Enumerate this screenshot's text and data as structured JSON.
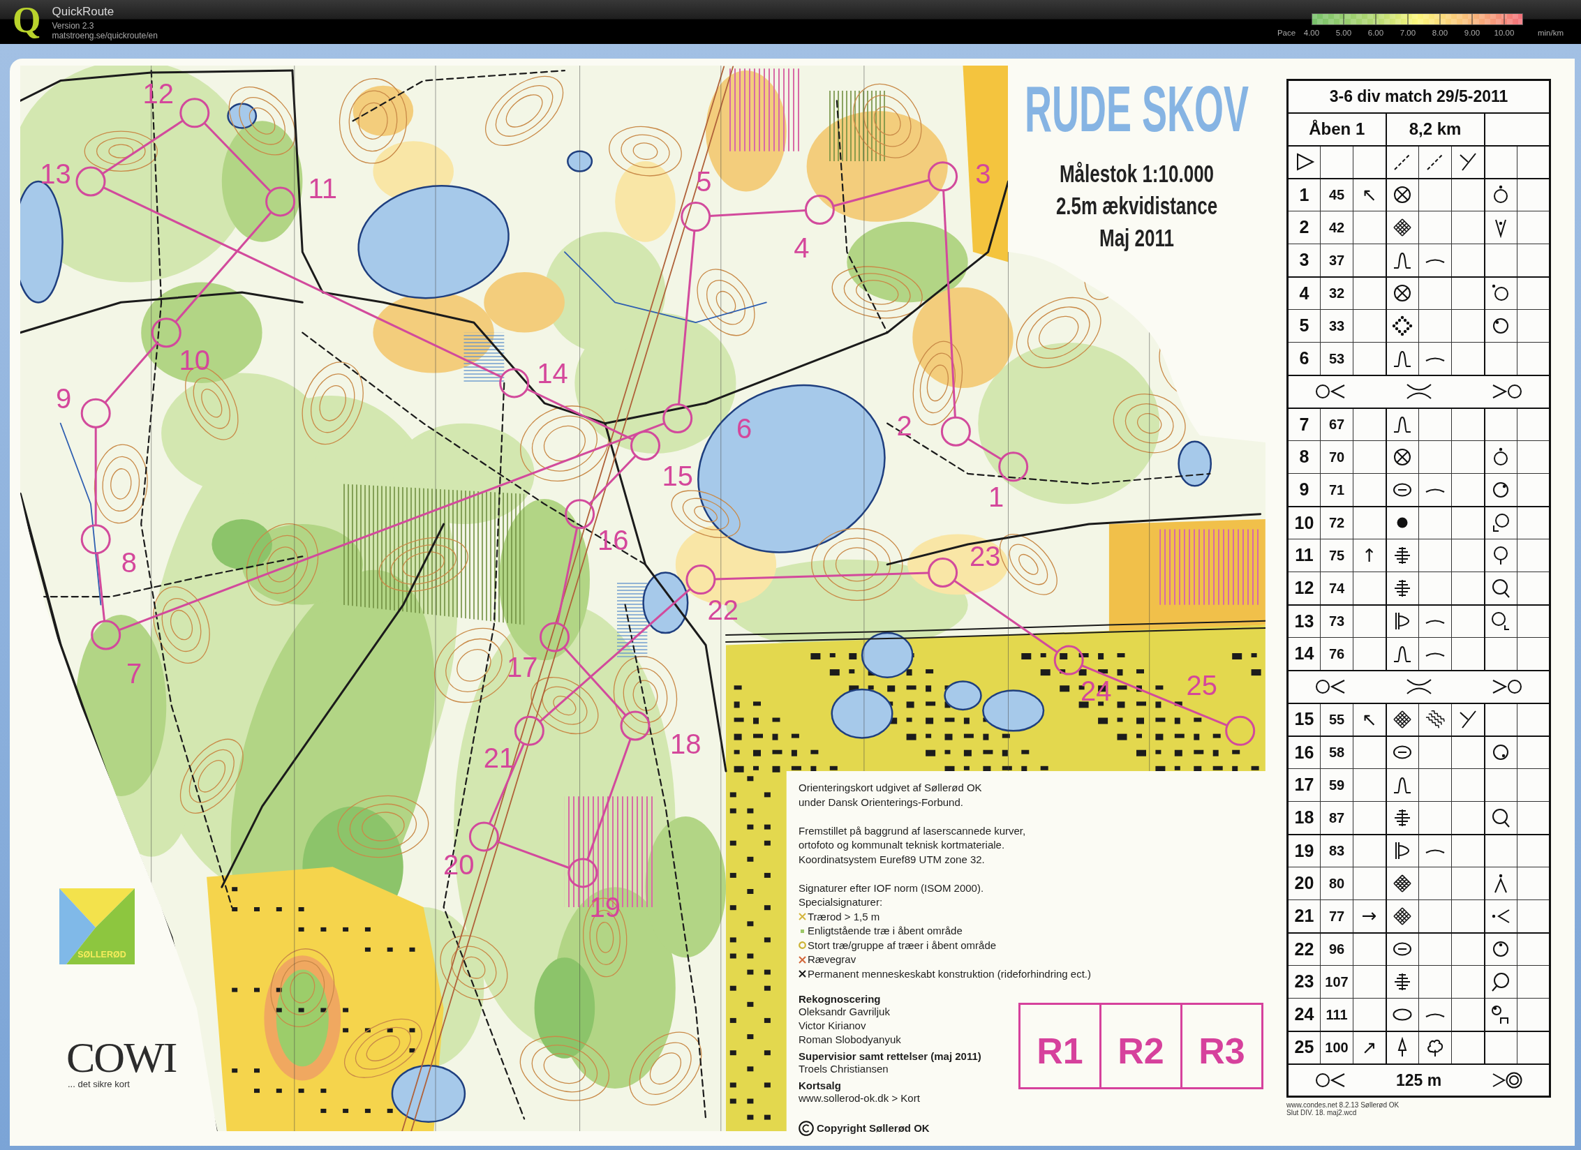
{
  "app_bar": {
    "logo_letter": "Q",
    "name": "QuickRoute",
    "version": "Version 2.3",
    "url": "matstroeng.se/quickroute/en",
    "pace_legend": {
      "label": "Pace",
      "ticks": [
        "4.00",
        "5.00",
        "6.00",
        "7.00",
        "8.00",
        "9.00",
        "10.00"
      ],
      "unit": "min/km"
    }
  },
  "map": {
    "title": "RUDE SKOV",
    "info_lines": [
      "Målestok 1:10.000",
      "2.5m ækvidistance",
      "Maj 2011"
    ],
    "controls": [
      {
        "number": "1"
      },
      {
        "number": "2"
      },
      {
        "number": "3"
      },
      {
        "number": "4"
      },
      {
        "number": "5"
      },
      {
        "number": "6"
      },
      {
        "number": "7"
      },
      {
        "number": "8"
      },
      {
        "number": "9"
      },
      {
        "number": "10"
      },
      {
        "number": "11"
      },
      {
        "number": "12"
      },
      {
        "number": "13"
      },
      {
        "number": "14"
      },
      {
        "number": "15"
      },
      {
        "number": "16"
      },
      {
        "number": "17"
      },
      {
        "number": "18"
      },
      {
        "number": "19"
      },
      {
        "number": "20"
      },
      {
        "number": "21"
      },
      {
        "number": "22"
      },
      {
        "number": "23"
      },
      {
        "number": "24"
      },
      {
        "number": "25"
      }
    ],
    "club_logo": {
      "text": "SØLLERØD"
    },
    "sponsor_logo": {
      "name": "COWI",
      "tagline": "... det sikre kort"
    },
    "legend": {
      "paragraphs": [
        "Orienteringskort udgivet af Søllerød OK\nunder Dansk Orienterings-Forbund.",
        "Fremstillet på baggrund af laserscannede kurver,\nortofoto og kommunalt teknisk kortmateriale.\nKoordinatsystem Euref89 UTM zone 32.",
        "Signaturer efter IOF norm (ISOM 2000).\nSpecialsignaturer:"
      ],
      "special_symbols": [
        {
          "kind": "cross",
          "color": "#d4b63e",
          "text": "Trærod > 1,5 m"
        },
        {
          "kind": "dot",
          "color": "#9cc866",
          "text": "Enligtstående træ i åbent område"
        },
        {
          "kind": "ring",
          "color": "#cbb233",
          "text": "Stort træ/gruppe af træer i åbent område"
        },
        {
          "kind": "cross",
          "color": "#d2673a",
          "text": "Rævegrav"
        },
        {
          "kind": "cross",
          "color": "#1a1a1a",
          "text": "Permanent menneskeskabt konstruktion (rideforhindring ect.)"
        }
      ],
      "credits": [
        {
          "heading": "Rekognoscering",
          "lines": [
            "Oleksandr Gavriljuk",
            "Victor Kirianov",
            "Roman Slobodyanyuk"
          ]
        },
        {
          "heading": "Supervisior samt rettelser (maj 2011)",
          "lines": [
            "Troels Christiansen"
          ]
        },
        {
          "heading": "Kortsalg",
          "lines": [
            "www.sollerod-ok.dk > Kort"
          ]
        }
      ],
      "copyright": "Copyright Søllerød OK"
    },
    "boxes": [
      "R1",
      "R2",
      "R3"
    ]
  },
  "control_descriptions": {
    "title": "3-6 div match 29/5-2011",
    "course": "Åben 1",
    "length": "8,2 km",
    "rows": [
      {
        "kind": "start",
        "column_d": {
          "kind": "dashed-line"
        },
        "column_e": {
          "kind": "dashed-line"
        },
        "column_f": {
          "kind": "fork"
        }
      },
      {
        "kind": "control",
        "number": "1",
        "code": "45",
        "column_c": {
          "text": "↖"
        },
        "column_d": {
          "kind": "crossed-circle"
        },
        "column_g": {
          "kind": "ring-dot-above"
        }
      },
      {
        "kind": "control",
        "number": "2",
        "code": "42",
        "column_d": {
          "kind": "mesh"
        },
        "column_g": {
          "kind": "v-dot"
        }
      },
      {
        "kind": "control",
        "number": "3",
        "code": "37",
        "column_d": {
          "kind": "bump"
        },
        "column_e": {
          "kind": "arc"
        }
      },
      {
        "kind": "control",
        "number": "4",
        "code": "32",
        "column_d": {
          "kind": "crossed-circle"
        },
        "column_g": {
          "kind": "ring-dot-upper-left"
        }
      },
      {
        "kind": "control",
        "number": "5",
        "code": "33",
        "column_d": {
          "kind": "dotted-diamond"
        },
        "column_g": {
          "kind": "ring-dot-inside-upper-left"
        }
      },
      {
        "kind": "control",
        "number": "6",
        "code": "53",
        "column_d": {
          "kind": "bump"
        },
        "column_e": {
          "kind": "arc"
        }
      },
      {
        "kind": "route"
      },
      {
        "kind": "control",
        "number": "7",
        "code": "67",
        "column_d": {
          "kind": "bump"
        }
      },
      {
        "kind": "control",
        "number": "8",
        "code": "70",
        "column_d": {
          "kind": "crossed-circle"
        },
        "column_g": {
          "kind": "ring-dot-above"
        }
      },
      {
        "kind": "control",
        "number": "9",
        "code": "71",
        "column_d": {
          "kind": "barred-oval"
        },
        "column_e": {
          "kind": "arc"
        },
        "column_g": {
          "kind": "ring-dot-inside-upper-right"
        }
      },
      {
        "kind": "control",
        "number": "10",
        "code": "72",
        "column_d": {
          "kind": "dot"
        },
        "column_g": {
          "kind": "ring-corner-lower-left"
        }
      },
      {
        "kind": "control",
        "number": "11",
        "code": "75",
        "column_c": {
          "text": "↑"
        },
        "column_d": {
          "kind": "striped"
        },
        "column_g": {
          "kind": "ring-tail-bottom"
        }
      },
      {
        "kind": "control",
        "number": "12",
        "code": "74",
        "column_d": {
          "kind": "striped"
        },
        "column_g": {
          "kind": "ring-tail-lower-right"
        }
      },
      {
        "kind": "control",
        "number": "13",
        "code": "73",
        "column_d": {
          "kind": "flag"
        },
        "column_e": {
          "kind": "arc"
        },
        "column_g": {
          "kind": "ring-corner-lower-right"
        }
      },
      {
        "kind": "control",
        "number": "14",
        "code": "76",
        "column_d": {
          "kind": "bump"
        },
        "column_e": {
          "kind": "arc"
        }
      },
      {
        "kind": "route"
      },
      {
        "kind": "control",
        "number": "15",
        "code": "55",
        "column_c": {
          "text": "↖"
        },
        "column_d": {
          "kind": "mesh"
        },
        "column_e": {
          "kind": "waves"
        },
        "column_f": {
          "kind": "fork"
        }
      },
      {
        "kind": "control",
        "number": "16",
        "code": "58",
        "column_d": {
          "kind": "barred-oval"
        },
        "column_g": {
          "kind": "ring-dot-inside-lower-right"
        }
      },
      {
        "kind": "control",
        "number": "17",
        "code": "59",
        "column_d": {
          "kind": "bump"
        }
      },
      {
        "kind": "control",
        "number": "18",
        "code": "87",
        "column_d": {
          "kind": "striped"
        },
        "column_g": {
          "kind": "ring-tail-lower-right"
        }
      },
      {
        "kind": "control",
        "number": "19",
        "code": "83",
        "column_d": {
          "kind": "flag"
        },
        "column_e": {
          "kind": "arc"
        }
      },
      {
        "kind": "control",
        "number": "20",
        "code": "80",
        "column_d": {
          "kind": "mesh"
        },
        "column_g": {
          "kind": "peak-dot"
        }
      },
      {
        "kind": "control",
        "number": "21",
        "code": "77",
        "column_c": {
          "text": "→"
        },
        "column_d": {
          "kind": "mesh"
        },
        "column_g": {
          "kind": "dot-chevron"
        }
      },
      {
        "kind": "control",
        "number": "22",
        "code": "96",
        "column_d": {
          "kind": "barred-oval"
        },
        "column_g": {
          "kind": "ring-dot-inside-top"
        }
      },
      {
        "kind": "control",
        "number": "23",
        "code": "107",
        "column_d": {
          "kind": "striped"
        },
        "column_g": {
          "kind": "ring-tail-lower-left"
        }
      },
      {
        "kind": "control",
        "number": "24",
        "code": "111",
        "column_d": {
          "kind": "ellipse"
        },
        "column_e": {
          "kind": "arc"
        },
        "column_g": {
          "kind": "ring-gate"
        }
      },
      {
        "kind": "control",
        "number": "25",
        "code": "100",
        "column_c": {
          "text": "↗"
        },
        "column_d": {
          "kind": "conifer"
        },
        "column_e": {
          "kind": "tree"
        }
      },
      {
        "kind": "finish",
        "distance": "125 m"
      }
    ],
    "footer_lines": [
      "www.condes.net 8.2.13 Søllerød OK",
      "Slut DIV. 18. maj2.wcd"
    ]
  }
}
